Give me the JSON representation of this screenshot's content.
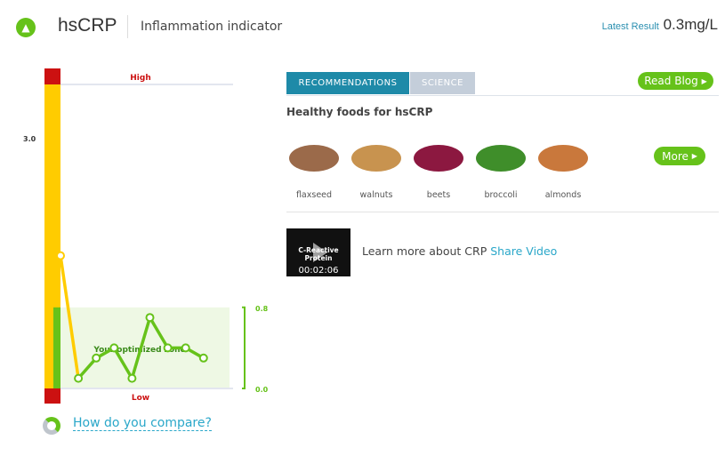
{
  "header": {
    "icon": "flame-icon",
    "title": "hsCRP",
    "subtitle": "Inflammation indicator",
    "latest_label": "Latest Result",
    "latest_value": "0.3mg/L"
  },
  "chart_data": {
    "type": "line",
    "y_ticks": [
      "3.0",
      "0.0"
    ],
    "ylim": [
      0,
      3.0
    ],
    "band_labels": {
      "high": "High",
      "low": "Low"
    },
    "optimized_zone": {
      "label": "Your optimized zone",
      "range": [
        0,
        0.8
      ],
      "tick_labels": [
        "0.8",
        "0.0"
      ]
    },
    "values": [
      1.31,
      0.1,
      0.3,
      0.4,
      0.1,
      0.7,
      0.4,
      0.4,
      0.3
    ],
    "colors": {
      "high": "#cc1111",
      "mid": "#ffcc00",
      "zone": "#66c21a",
      "zone_bg": "#eef8e4"
    }
  },
  "tabs": [
    {
      "label": "RECOMMENDATIONS",
      "active": true
    },
    {
      "label": "SCIENCE",
      "active": false
    }
  ],
  "read_blog": "Read Blog",
  "foods_title": "Healthy foods for hsCRP",
  "foods": [
    {
      "label": "flaxseed",
      "color": "#9b6a4a"
    },
    {
      "label": "walnuts",
      "color": "#c8934f"
    },
    {
      "label": "beets",
      "color": "#8c1840"
    },
    {
      "label": "broccoli",
      "color": "#3f8e2a"
    },
    {
      "label": "almonds",
      "color": "#c9783c"
    }
  ],
  "more": "More",
  "video": {
    "title": "C-Reactive Protein",
    "duration": "00:02:06"
  },
  "learn_text": "Learn more about CRP",
  "share_video": "Share Video",
  "compare": "How do you compare?"
}
